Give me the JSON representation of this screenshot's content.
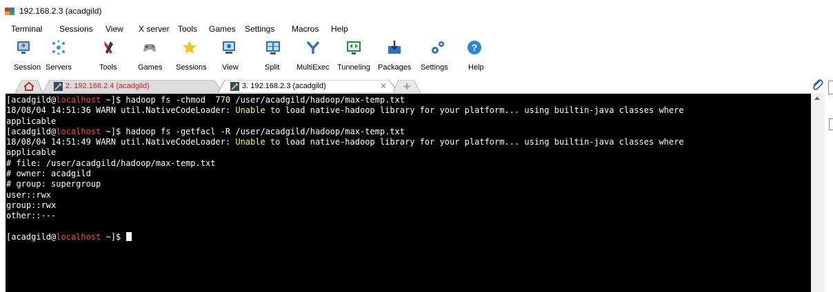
{
  "window": {
    "title": "192.168.2.3 (acadgild)"
  },
  "menu": [
    {
      "label": "Terminal"
    },
    {
      "label": "Sessions"
    },
    {
      "label": "View"
    },
    {
      "label": "X server"
    },
    {
      "label": "Tools"
    },
    {
      "label": "Games"
    },
    {
      "label": "Settings"
    },
    {
      "label": "Macros"
    },
    {
      "label": "Help"
    }
  ],
  "toolbar": [
    {
      "label": "Session",
      "icon": "session-icon"
    },
    {
      "label": "Servers",
      "icon": "servers-icon"
    },
    {
      "label": "Tools",
      "icon": "tools-icon"
    },
    {
      "label": "Games",
      "icon": "games-icon"
    },
    {
      "label": "Sessions",
      "icon": "sessions-star-icon"
    },
    {
      "label": "View",
      "icon": "view-icon"
    },
    {
      "label": "Split",
      "icon": "split-icon"
    },
    {
      "label": "MultiExec",
      "icon": "multiexec-icon"
    },
    {
      "label": "Tunneling",
      "icon": "tunneling-icon"
    },
    {
      "label": "Packages",
      "icon": "packages-icon"
    },
    {
      "label": "Settings",
      "icon": "settings-icon"
    },
    {
      "label": "Help",
      "icon": "help-icon"
    }
  ],
  "tabs": [
    {
      "label": "2. 192.168.2.4 (acadgild)",
      "active": false
    },
    {
      "label": "3. 192.168.2.3 (acadgild)",
      "active": true
    }
  ],
  "terminal": {
    "lines": [
      [
        {
          "t": "[acadgild@"
        },
        {
          "t": "localhost",
          "c": "red"
        },
        {
          "t": " ~]$ hadoop fs -chmod  770 /user/acadgild/hadoop/max-temp.txt"
        }
      ],
      [
        {
          "t": "18/08/04 14:51:36 WARN util.NativeCodeLoader: "
        },
        {
          "t": "Unable to",
          "c": "yel"
        },
        {
          "t": " load native-hadoop library for your platform... using builtin-java classes where"
        }
      ],
      [
        {
          "t": "applicable"
        }
      ],
      [
        {
          "t": "[acadgild@"
        },
        {
          "t": "localhost",
          "c": "red"
        },
        {
          "t": " ~]$ hadoop fs -getfacl -R /user/acadgild/hadoop/max-temp.txt"
        }
      ],
      [
        {
          "t": "18/08/04 14:51:49 WARN util.NativeCodeLoader: "
        },
        {
          "t": "Unable to",
          "c": "yel"
        },
        {
          "t": " load native-hadoop library for your platform... using builtin-java classes where"
        }
      ],
      [
        {
          "t": "applicable"
        }
      ],
      [
        {
          "t": "# file: /user/acadgild/hadoop/max-temp.txt"
        }
      ],
      [
        {
          "t": "# owner: acadgild"
        }
      ],
      [
        {
          "t": "# group: supergroup"
        }
      ],
      [
        {
          "t": "user::rwx"
        }
      ],
      [
        {
          "t": "group::rwx"
        }
      ],
      [
        {
          "t": "other::---"
        }
      ],
      [],
      [
        {
          "t": "[acadgild@"
        },
        {
          "t": "localhost",
          "c": "red"
        },
        {
          "t": " ~]$ "
        }
      ]
    ]
  },
  "colors": {
    "terminal_bg": "#000000",
    "host_red": "#ff4040",
    "warn_yellow": "#ffff30"
  }
}
